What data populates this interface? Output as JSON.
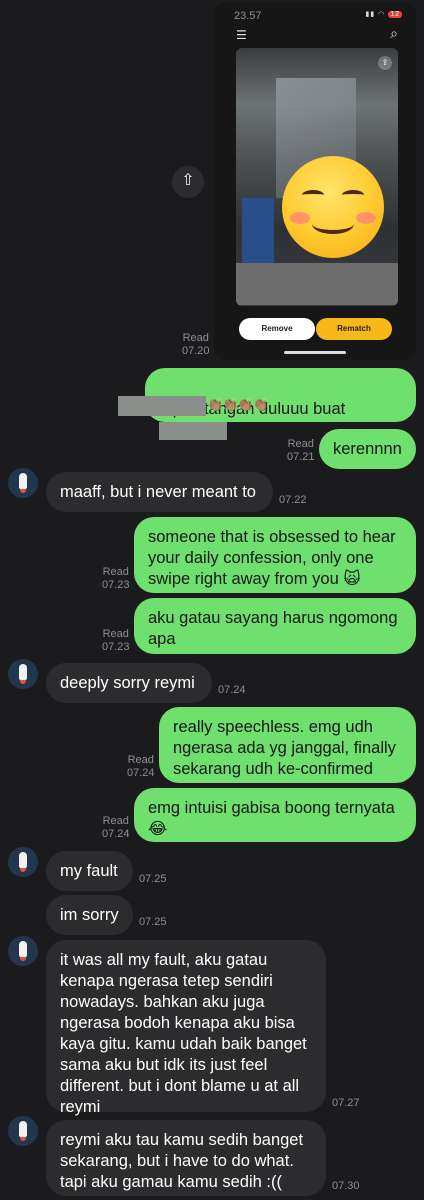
{
  "screenshot": {
    "status_time": "23.57",
    "battery": "12",
    "remove_label": "Remove",
    "rematch_label": "Rematch",
    "read": "Read",
    "time": "07.20"
  },
  "messages": [
    {
      "id": "m1",
      "side": "sent",
      "text": "tepuk tangan duluuu buat",
      "claps": "👏🏽👏🏽👏🏽👏🏽",
      "read": "Read",
      "time": "07.21"
    },
    {
      "id": "m2",
      "side": "sent",
      "text": "kerennnn",
      "read": "Read",
      "time": "07.21"
    },
    {
      "id": "m3",
      "side": "recv",
      "text": "maaff, but i never meant to",
      "time": "07.22"
    },
    {
      "id": "m4",
      "side": "sent",
      "text": "someone that is obsessed to hear\nyour daily confession, only one\nswipe right away from you 🙀",
      "read": "Read",
      "time": "07.23"
    },
    {
      "id": "m5",
      "side": "sent",
      "text": "aku gatau sayang harus ngomong\napa",
      "read": "Read",
      "time": "07.23"
    },
    {
      "id": "m6",
      "side": "recv",
      "text": "deeply sorry reymi",
      "time": "07.24"
    },
    {
      "id": "m7",
      "side": "sent",
      "text": "really speechless. emg udh\nngerasa ada yg janggal, finally\nsekarang udh ke-confirmed",
      "read": "Read",
      "time": "07.24"
    },
    {
      "id": "m8",
      "side": "sent",
      "text": "emg intuisi gabisa boong ternyata\n😂",
      "read": "Read",
      "time": "07.24"
    },
    {
      "id": "m9",
      "side": "recv",
      "text": "my fault",
      "time": "07.25"
    },
    {
      "id": "m10",
      "side": "recv",
      "text": "im sorry",
      "time": "07.25"
    },
    {
      "id": "m11",
      "side": "recv",
      "text": "it was all my fault, aku gatau\nkenapa ngerasa tetep sendiri\nnowadays. bahkan aku juga\nngerasa bodoh kenapa aku bisa\nkaya gitu. kamu udah baik banget\nsama aku but idk its just feel\ndifferent. but i dont blame u at all\nreymi",
      "time": "07.27"
    },
    {
      "id": "m12",
      "side": "recv",
      "text": "reymi aku tau kamu sedih banget\nsekarang, but i have to do what.\ntapi aku gamau kamu sedih :((",
      "time": "07.30"
    }
  ]
}
